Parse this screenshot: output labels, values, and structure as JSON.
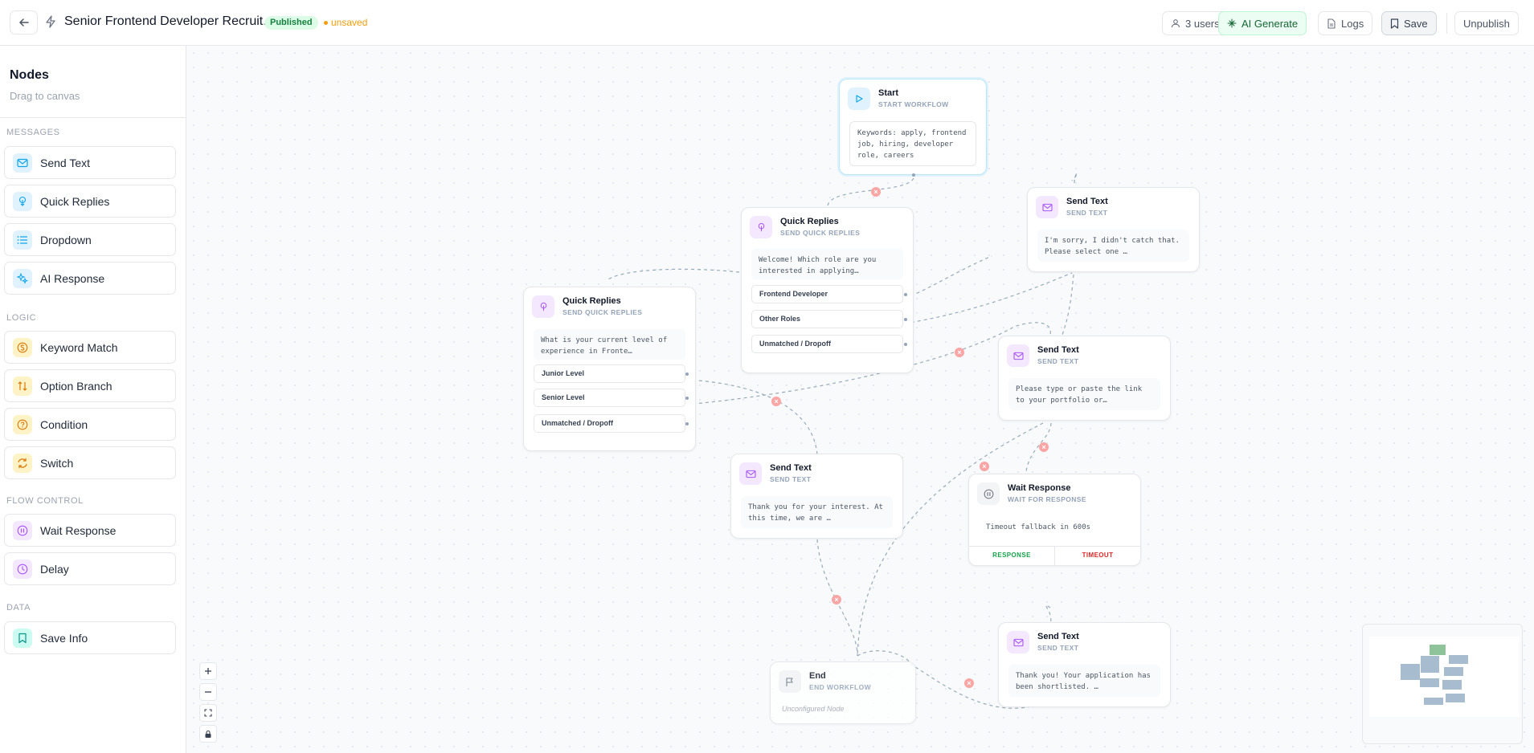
{
  "header": {
    "title": "Senior Frontend Developer Recruit...",
    "status_badge": "Published",
    "unsaved_label": "unsaved",
    "users_label": "3 users",
    "ai_generate_label": "AI Generate",
    "logs_label": "Logs",
    "save_label": "Save",
    "unpublish_label": "Unpublish"
  },
  "sidebar": {
    "title": "Nodes",
    "subtitle": "Drag to canvas",
    "sections": [
      {
        "label": "MESSAGES",
        "items": [
          {
            "label": "Send Text",
            "icon": "mail-icon"
          },
          {
            "label": "Quick Replies",
            "icon": "touch-icon"
          },
          {
            "label": "Dropdown",
            "icon": "list-icon"
          },
          {
            "label": "AI Response",
            "icon": "sparkle-icon"
          }
        ]
      },
      {
        "label": "LOGIC",
        "items": [
          {
            "label": "Keyword Match",
            "icon": "dollar-icon"
          },
          {
            "label": "Option Branch",
            "icon": "split-arrows-icon"
          },
          {
            "label": "Condition",
            "icon": "question-icon"
          },
          {
            "label": "Switch",
            "icon": "refresh-icon"
          }
        ]
      },
      {
        "label": "FLOW CONTROL",
        "items": [
          {
            "label": "Wait Response",
            "icon": "pause-icon"
          },
          {
            "label": "Delay",
            "icon": "clock-icon"
          }
        ]
      },
      {
        "label": "DATA",
        "items": [
          {
            "label": "Save Info",
            "icon": "bookmark-icon"
          }
        ]
      }
    ]
  },
  "nodes": {
    "start": {
      "title": "Start",
      "subtitle": "START WORKFLOW",
      "body": "Keywords: apply, frontend job, hiring, developer role, careers"
    },
    "qr_role": {
      "title": "Quick Replies",
      "subtitle": "SEND QUICK REPLIES",
      "body": "Welcome! Which role are you interested in applying…",
      "options": [
        "Frontend Developer",
        "Other Roles",
        "Unmatched / Dropoff"
      ]
    },
    "qr_level": {
      "title": "Quick Replies",
      "subtitle": "SEND QUICK REPLIES",
      "body": "What is your current level of experience in Fronte…",
      "options": [
        "Junior Level",
        "Senior Level",
        "Unmatched / Dropoff"
      ]
    },
    "st_sorry": {
      "title": "Send Text",
      "subtitle": "SEND TEXT",
      "body": "I'm sorry, I didn't catch that. Please select one …"
    },
    "st_portfolio": {
      "title": "Send Text",
      "subtitle": "SEND TEXT",
      "body": "Please type or paste the link to your portfolio or…"
    },
    "st_thanks": {
      "title": "Send Text",
      "subtitle": "SEND TEXT",
      "body": "Thank you for your interest. At this time, we are …"
    },
    "wait": {
      "title": "Wait Response",
      "subtitle": "WAIT FOR RESPONSE",
      "body": "Timeout fallback in 600s",
      "response_label": "RESPONSE",
      "timeout_label": "TIMEOUT"
    },
    "st_shortlisted": {
      "title": "Send Text",
      "subtitle": "SEND TEXT",
      "body": "Thank you! Your application has been shortlisted. …"
    },
    "end": {
      "title": "End",
      "subtitle": "END WORKFLOW",
      "note": "Unconfigured Node"
    }
  },
  "colors": {
    "accent_green": "#166534",
    "published_bg": "#dcfce7",
    "unsaved": "#f59e0b",
    "edge": "#9aaab8",
    "delete_marker": "#fca5a5"
  }
}
